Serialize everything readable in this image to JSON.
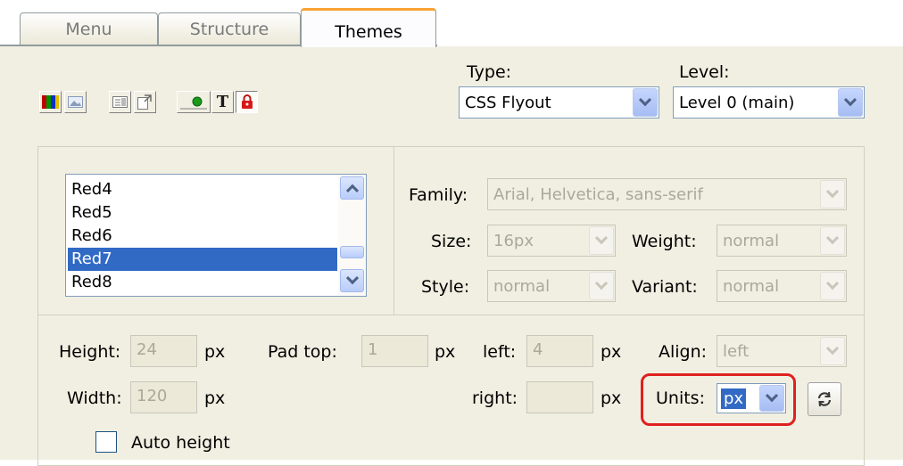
{
  "tabs": [
    {
      "label": "Menu"
    },
    {
      "label": "Structure"
    },
    {
      "label": "Themes",
      "active": true
    }
  ],
  "toolbar": {
    "icons": [
      "color-palette-icon",
      "image-icon",
      "list-layout-icon",
      "export-icon",
      "color-dot-icon",
      "font-t-icon",
      "lock-icon"
    ]
  },
  "type": {
    "label": "Type:",
    "value": "CSS Flyout"
  },
  "level": {
    "label": "Level:",
    "value": "Level 0 (main)"
  },
  "themes_list": {
    "items": [
      "Red4",
      "Red5",
      "Red6",
      "Red7",
      "Red8"
    ],
    "selected": "Red7"
  },
  "font": {
    "family_label": "Family:",
    "family_value": "Arial, Helvetica, sans-serif",
    "size_label": "Size:",
    "size_value": "16px",
    "weight_label": "Weight:",
    "weight_value": "normal",
    "style_label": "Style:",
    "style_value": "normal",
    "variant_label": "Variant:",
    "variant_value": "normal"
  },
  "dims": {
    "height_label": "Height:",
    "height_value": "24",
    "width_label": "Width:",
    "width_value": "120",
    "unit": "px",
    "pad_top_label": "Pad top:",
    "pad_top_value": "1",
    "left_label": "left:",
    "left_value": "4",
    "right_label": "right:",
    "right_value": "",
    "align_label": "Align:",
    "align_value": "left",
    "units_label": "Units:",
    "units_value": "px",
    "auto_height_label": "Auto height"
  },
  "colors": {
    "panel": "#f1efe2",
    "active_tab_accent": "#f7a233",
    "selection": "#316ac5",
    "highlight_ring": "#e02020"
  }
}
